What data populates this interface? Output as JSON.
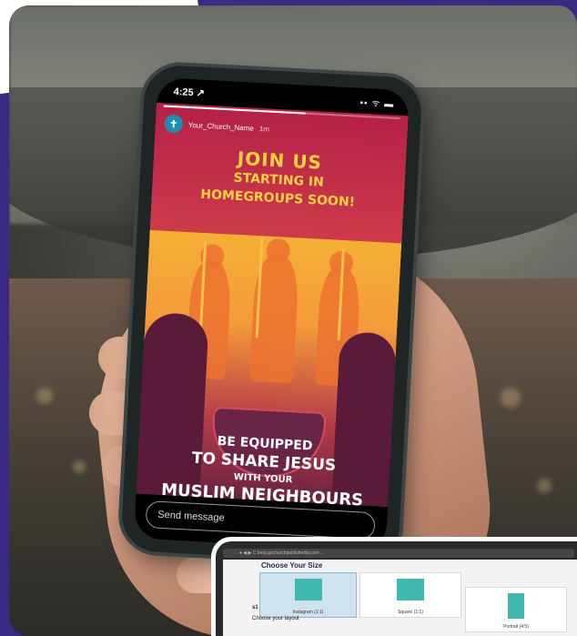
{
  "phone": {
    "time": "4:25 ↗",
    "status_icons": "▪▪ ᯤ ▬",
    "account_name": "Your_Church_Name",
    "post_age": "1m",
    "avatar_glyph": "✝",
    "headline_1": "JOIN US",
    "headline_2": "STARTING IN",
    "headline_3": "HOMEGROUPS SOON!",
    "bottom_1": "BE EQUIPPED",
    "bottom_2": "TO SHARE JESUS",
    "bottom_3": "WITH YOUR",
    "bottom_4": "MUSLIM NEIGHBOURS",
    "send_placeholder": "Send message"
  },
  "laptop": {
    "url": "● ◀ ▶ C  beta.gochurchpublishedia.com ...",
    "page_title": "Choose Your Size",
    "section_label": "Choose your layout",
    "section_number": "s1",
    "cards": [
      {
        "label": "Instagram (1:1)"
      },
      {
        "label": "Square (1:1)"
      },
      {
        "label": "Portrait (4:5)"
      }
    ]
  },
  "colors": {
    "brand_purple": "#3b2a85",
    "headline_yellow": "#ffd43c",
    "story_red": "#c22a4d"
  }
}
